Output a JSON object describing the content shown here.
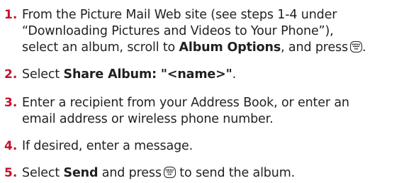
{
  "steps": [
    {
      "number": "1.",
      "lines": [
        "From the Picture Mail Web site (see steps 1-4 under",
        "“Downloading Pictures and Videos to Your Phone”),"
      ],
      "line3_pre": "select an album, scroll to ",
      "line3_bold": "Album Options",
      "line3_post": ", and press",
      "line3_end": "."
    },
    {
      "number": "2.",
      "pre": "Select ",
      "bold": "Share Album: \"<name>\"",
      "post": "."
    },
    {
      "number": "3.",
      "lines": [
        "Enter a recipient from your Address Book, or enter an",
        "email address or wireless phone number."
      ]
    },
    {
      "number": "4.",
      "text": "If desired, enter a message."
    },
    {
      "number": "5.",
      "pre": "Select ",
      "bold": "Send",
      "mid": " and press",
      "post": " to send the album."
    }
  ],
  "menu_ok_key": {
    "icon": "menu-ok-key-icon",
    "top": "MENU",
    "bottom": "OK"
  },
  "colors": {
    "step_number": "#c2122d",
    "text": "#231f20"
  }
}
